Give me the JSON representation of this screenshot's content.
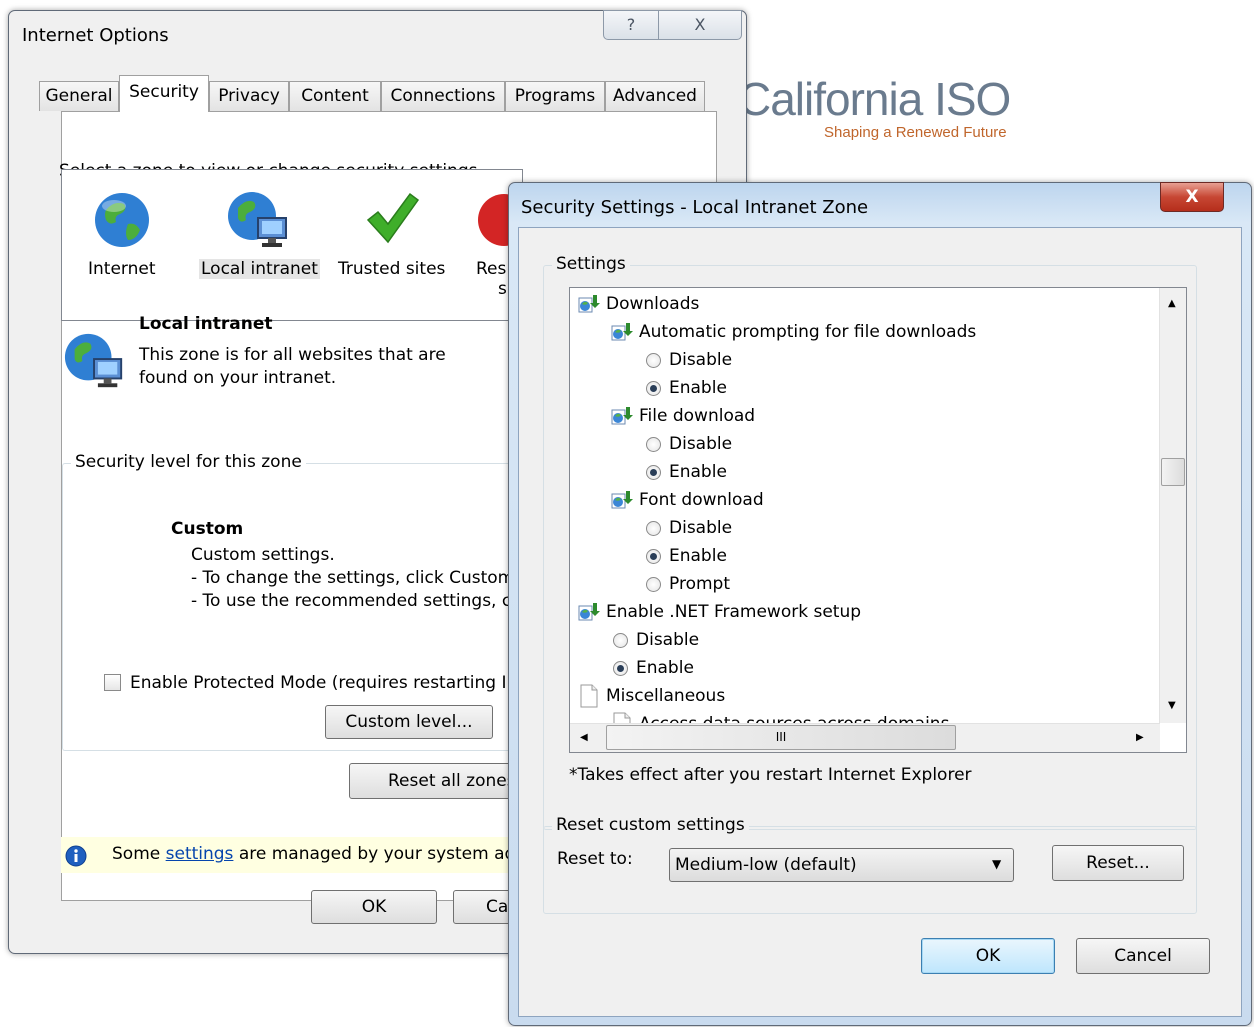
{
  "background": {
    "logo_main": "California ISO",
    "logo_sub": "Shaping a Renewed Future"
  },
  "internet_options": {
    "title": "Internet Options",
    "help_glyph": "?",
    "close_glyph": "X",
    "tabs": [
      "General",
      "Security",
      "Privacy",
      "Content",
      "Connections",
      "Programs",
      "Advanced"
    ],
    "active_tab": "Security",
    "zone_prompt": "Select a zone to view or change security settings.",
    "zones": [
      {
        "label": "Internet",
        "icon": "globe-icon"
      },
      {
        "label": "Local intranet",
        "icon": "intranet-globe-icon"
      },
      {
        "label": "Trusted sites",
        "icon": "checkmark-icon"
      },
      {
        "label": "Res",
        "label2": "s",
        "icon": "restricted-icon"
      }
    ],
    "zone_title": "Local intranet",
    "zone_desc_line1": "This zone is for all websites that are",
    "zone_desc_line2": "found on your intranet.",
    "level_group": "Security level for this zone",
    "level_name": "Custom",
    "level_line1": "Custom settings.",
    "level_line2": "- To change the settings, click Custom",
    "level_line3": "- To use the recommended settings, c",
    "protected_mode": "Enable Protected Mode (requires restarting In",
    "protected_mode_checked": false,
    "custom_level_btn": "Custom level...",
    "reset_all_btn": "Reset all zones",
    "info_prefix": "Some ",
    "info_link": "settings",
    "info_suffix": " are managed by your system adr",
    "ok": "OK",
    "cancel": "Ca"
  },
  "security_settings": {
    "title": "Security Settings - Local Intranet Zone",
    "close_glyph": "X",
    "settings_group": "Settings",
    "tree": [
      {
        "label": "Downloads",
        "kind": "category",
        "indent": 0
      },
      {
        "label": "Automatic prompting for file downloads",
        "kind": "setting",
        "indent": 1
      },
      {
        "label": "Disable",
        "kind": "radio",
        "indent": 2,
        "checked": false
      },
      {
        "label": "Enable",
        "kind": "radio",
        "indent": 2,
        "checked": true
      },
      {
        "label": "File download",
        "kind": "setting",
        "indent": 1
      },
      {
        "label": "Disable",
        "kind": "radio",
        "indent": 2,
        "checked": false
      },
      {
        "label": "Enable",
        "kind": "radio",
        "indent": 2,
        "checked": true
      },
      {
        "label": "Font download",
        "kind": "setting",
        "indent": 1
      },
      {
        "label": "Disable",
        "kind": "radio",
        "indent": 2,
        "checked": false
      },
      {
        "label": "Enable",
        "kind": "radio",
        "indent": 2,
        "checked": true
      },
      {
        "label": "Prompt",
        "kind": "radio",
        "indent": 2,
        "checked": false
      },
      {
        "label": "Enable .NET Framework setup",
        "kind": "category",
        "indent": 0
      },
      {
        "label": "Disable",
        "kind": "radio",
        "indent": 1,
        "checked": false
      },
      {
        "label": "Enable",
        "kind": "radio",
        "indent": 1,
        "checked": true
      },
      {
        "label": "Miscellaneous",
        "kind": "page",
        "indent": 0
      },
      {
        "label": "Access data sources across domains",
        "kind": "page",
        "indent": 1
      }
    ],
    "hscroll_grip": "III",
    "restart_note": "*Takes effect after you restart Internet Explorer",
    "reset_group": "Reset custom settings",
    "reset_to_label": "Reset to:",
    "reset_to_value": "Medium-low (default)",
    "reset_btn": "Reset...",
    "ok": "OK",
    "cancel": "Cancel"
  }
}
